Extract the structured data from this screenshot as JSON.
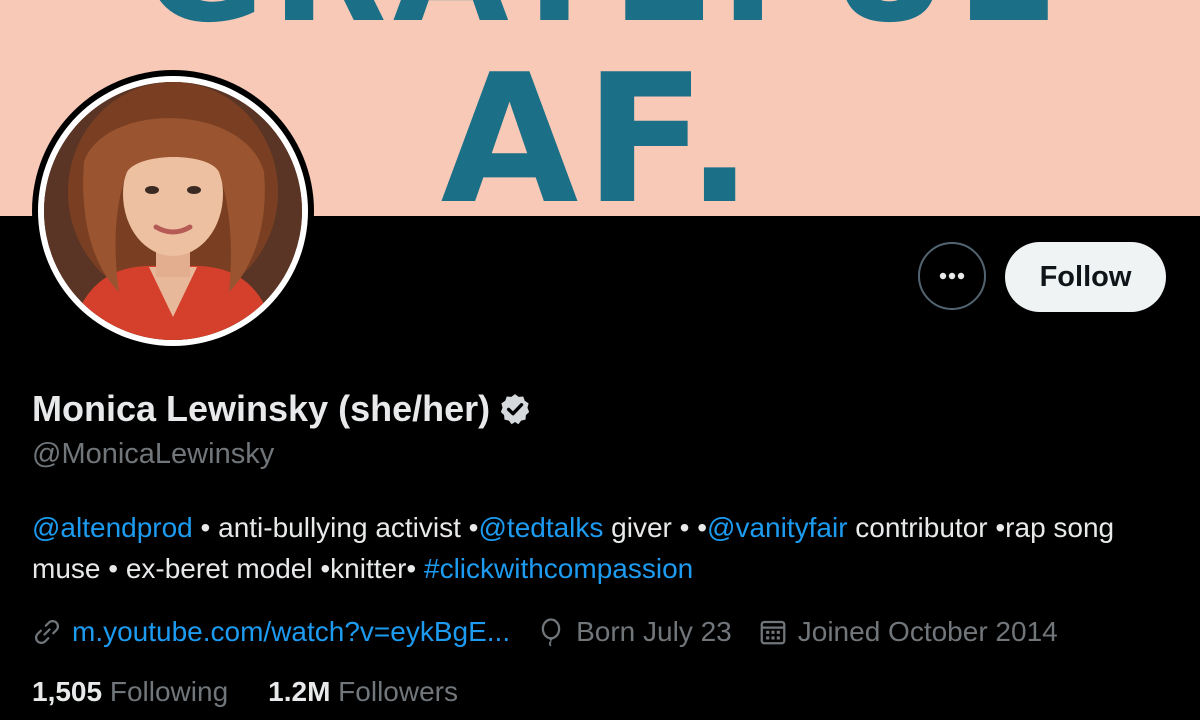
{
  "banner": {
    "top_text": "GRATEFUL",
    "main_text": "AF."
  },
  "profile": {
    "display_name": "Monica Lewinsky (she/her)",
    "handle": "@MonicaLewinsky",
    "follow_label": "Follow",
    "more_icon": "more-horizontal-icon",
    "verified_icon": "verified-badge-icon"
  },
  "bio": {
    "parts": [
      {
        "text": "@altendprod",
        "link": true
      },
      {
        "text": " • anti-bullying activist •",
        "link": false
      },
      {
        "text": "@tedtalks",
        "link": true
      },
      {
        "text": " giver • •",
        "link": false
      },
      {
        "text": "@vanityfair",
        "link": true
      },
      {
        "text": " contributor •rap song muse • ex-beret model •knitter• ",
        "link": false
      },
      {
        "text": "#clickwithcompassion",
        "link": true
      }
    ]
  },
  "meta": {
    "website": "m.youtube.com/watch?v=eykBgE...",
    "birthday": "Born July 23",
    "joined": "Joined October 2014"
  },
  "counts": {
    "following_num": "1,505",
    "following_label": "Following",
    "followers_num": "1.2M",
    "followers_label": "Followers"
  },
  "colors": {
    "accent": "#1d9bf0",
    "banner_bg": "#f8c9b7",
    "banner_text": "#1b6f87"
  }
}
